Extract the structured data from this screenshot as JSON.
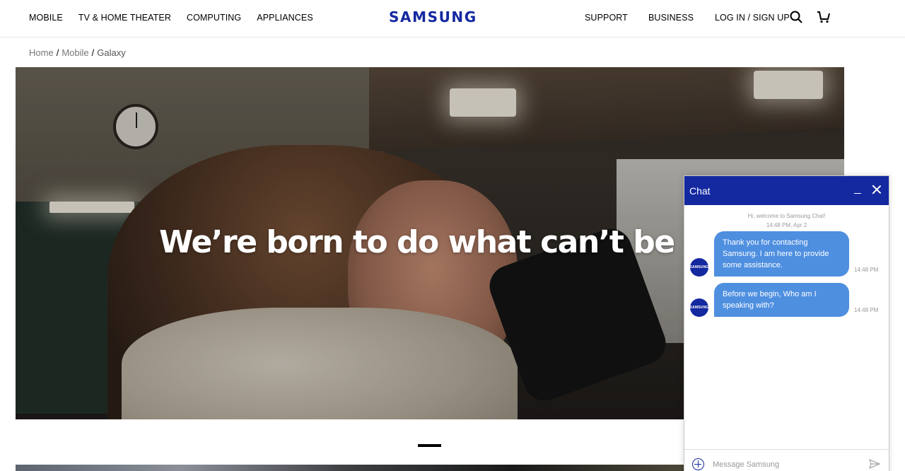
{
  "nav": {
    "left_items": [
      "MOBILE",
      "TV & HOME THEATER",
      "COMPUTING",
      "APPLIANCES"
    ],
    "logo": "SAMSUNG",
    "right_items": [
      "SUPPORT",
      "BUSINESS",
      "LOG IN / SIGN UP"
    ],
    "icons": [
      "search-icon",
      "cart-icon"
    ]
  },
  "breadcrumb": {
    "items": [
      "Home",
      "Mobile",
      "Galaxy"
    ],
    "separator": "/"
  },
  "hero": {
    "headline": "We’re born to do what can’t be done."
  },
  "chat": {
    "title": "Chat",
    "welcome": "Hi, welcome to Samsung Chat!",
    "welcome_time": "14:48 PM, Apr 2",
    "avatar_label": "SAMSUNG",
    "messages": [
      {
        "text": "Thank you for contacting Samsung. I am here to provide some assistance.",
        "time": "14:48 PM"
      },
      {
        "text": "Before we begin, Who am I speaking with?",
        "time": "14:48 PM"
      }
    ],
    "input_placeholder": "Message Samsung"
  },
  "colors": {
    "brand_blue": "#1428a0",
    "bubble_blue": "#4e8fe0"
  }
}
